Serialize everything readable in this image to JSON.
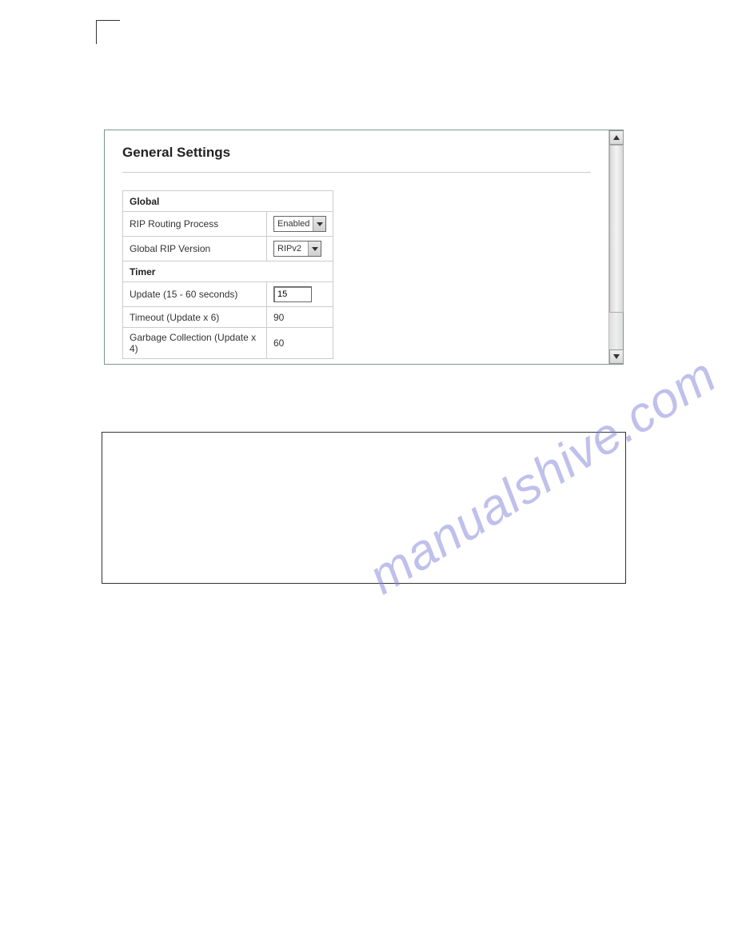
{
  "panel": {
    "title": "General Settings",
    "sections": {
      "global": {
        "header": "Global",
        "rows": [
          {
            "label": "RIP Routing Process",
            "value": "Enabled",
            "type": "select"
          },
          {
            "label": "Global RIP Version",
            "value": "RIPv2",
            "type": "select"
          }
        ]
      },
      "timer": {
        "header": "Timer",
        "rows": [
          {
            "label": "Update (15 - 60 seconds)",
            "value": "15",
            "type": "input"
          },
          {
            "label": "Timeout (Update x 6)",
            "value": "90",
            "type": "text"
          },
          {
            "label": "Garbage Collection (Update x 4)",
            "value": "60",
            "type": "text"
          }
        ]
      }
    }
  },
  "watermark": "manualshive.com"
}
